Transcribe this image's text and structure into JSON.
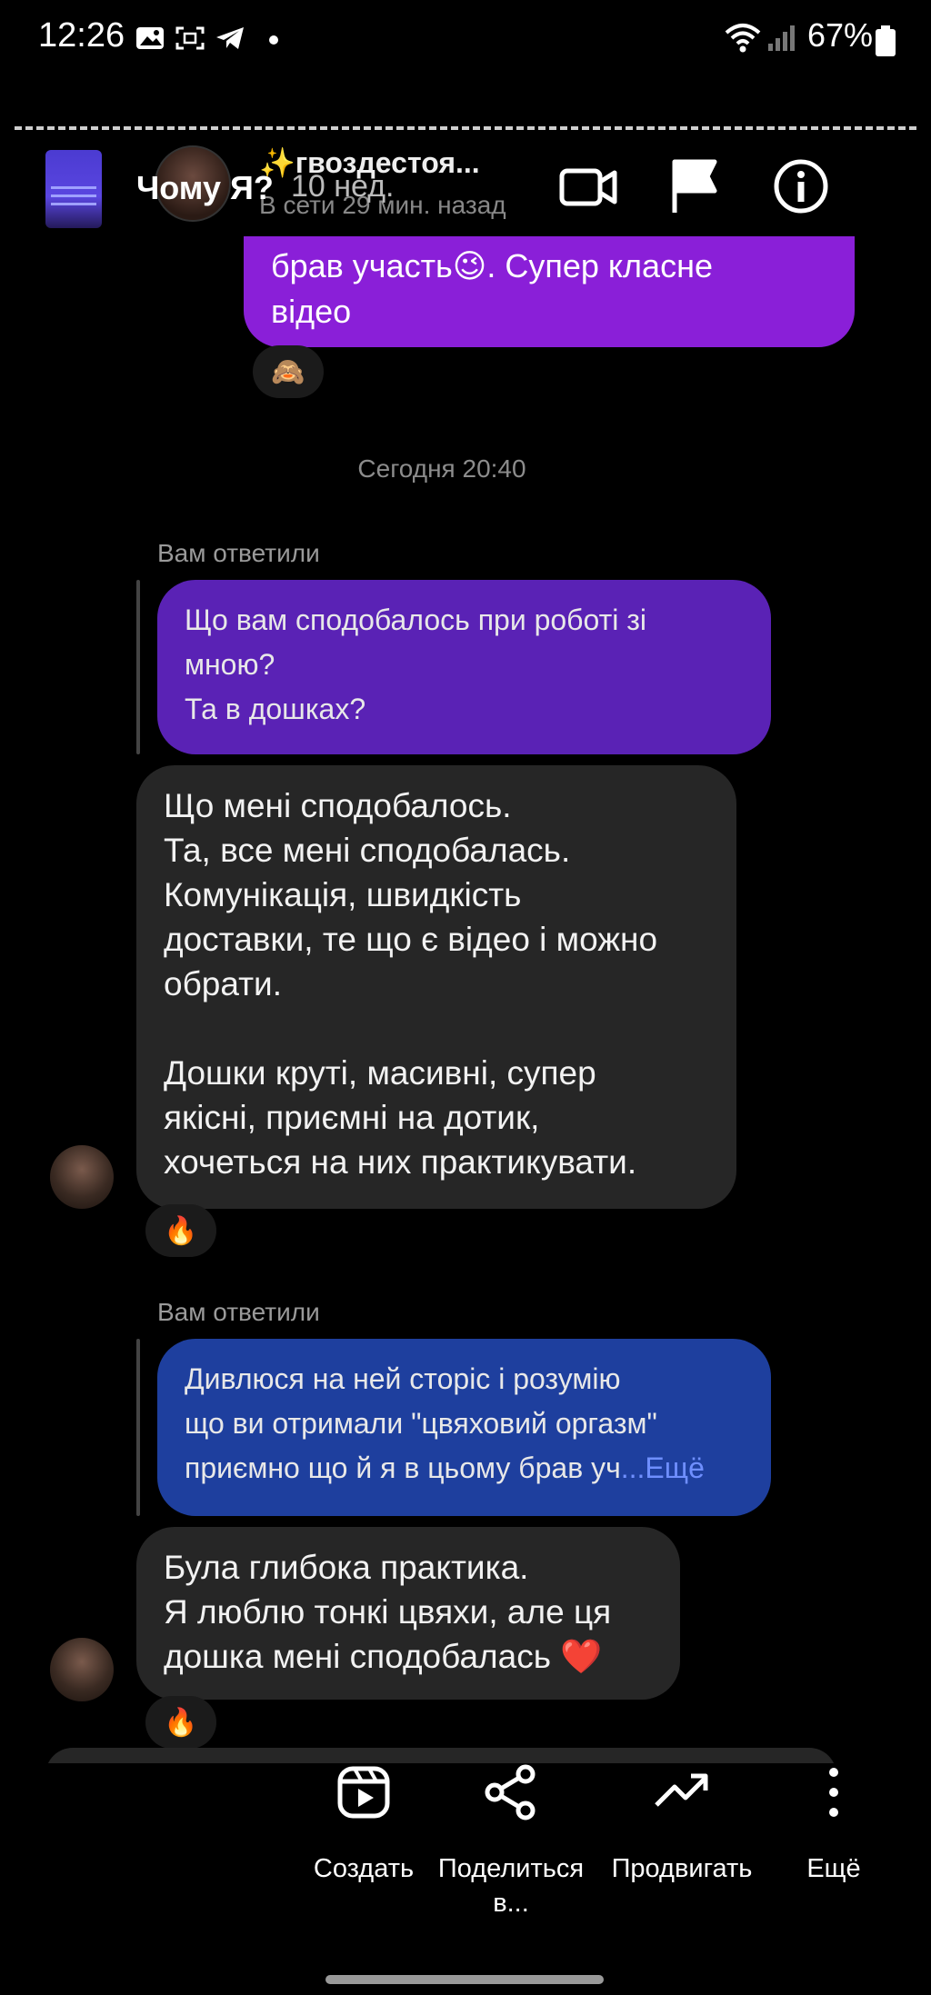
{
  "status_bar": {
    "time": "12:26",
    "battery": "67%",
    "icons": [
      "gallery-icon",
      "screenshot-icon",
      "telegram-icon",
      "dot-icon",
      "wifi-icon",
      "signal-icon",
      "battery-icon"
    ]
  },
  "header": {
    "title": "Чому Я?",
    "weeks": "10 нед.",
    "chat_name": "✨гвоздестоя...",
    "chat_status": "В сети 29 мин. назад",
    "icons": [
      "video-camera-icon",
      "flag-icon",
      "info-icon"
    ]
  },
  "messages": {
    "top_bubble_text": "брав участь😉. Супер класне\nвідео",
    "top_reaction": "🙈",
    "date_separator": "Сегодня 20:40",
    "reply1": {
      "label": "Вам ответили",
      "quoted": "Що вам сподобалось при роботі зі\nмною?\nТа в дошках?",
      "text": "Що мені сподобалось.\nТа, все мені сподобалась.\nКомунікація, швидкість\nдоставки, те що є відео і можно\nобрати.\n\nДошки круті, масивні,  супер\nякісні, приємні на дотик,\nхочеться на них практикувати.",
      "reaction": "🔥"
    },
    "reply2": {
      "label": "Вам ответили",
      "quoted": "Дивлюся на ней сторіс і розумію\nщо ви отримали \"цвяховий оргазм\"\nприємно що й я в цьому брав уч",
      "more": "...Ещё",
      "text": "Була глибока практика.\nЯ люблю тонкі цвяхи, але ця\nдошка мені сподобалась ❤️",
      "reaction": "🔥"
    }
  },
  "toolbar": {
    "create": "Создать",
    "share": "Поделиться\nв...",
    "promote": "Продвигать",
    "more": "Ещё"
  },
  "colors": {
    "top_bubble": "#8a1fd8",
    "reply1_bubble": "#5a22b5",
    "reply2_bubble": "#1e3f9e",
    "their_bubble": "#262626"
  }
}
